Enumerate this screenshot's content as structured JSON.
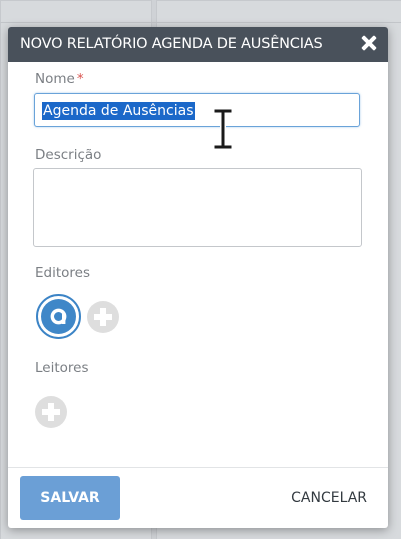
{
  "modal": {
    "title": "NOVO RELATÓRIO AGENDA DE AUSÊNCIAS",
    "close_icon": "close-icon"
  },
  "form": {
    "name": {
      "label": "Nome",
      "required_marker": "*",
      "value": "Agenda de Ausências"
    },
    "description": {
      "label": "Descrição",
      "value": ""
    },
    "editors": {
      "label": "Editores",
      "avatar_icon": "user-avatar-icon",
      "add_icon": "add-circle-icon"
    },
    "readers": {
      "label": "Leitores",
      "add_icon": "add-circle-icon"
    }
  },
  "footer": {
    "save_label": "SALVAR",
    "cancel_label": "CANCELAR"
  },
  "colors": {
    "header_bg": "#49515b",
    "accent": "#3f87c8",
    "save_bg": "#6b9fd6",
    "required": "#d9534f",
    "selection": "#1b68c9"
  }
}
